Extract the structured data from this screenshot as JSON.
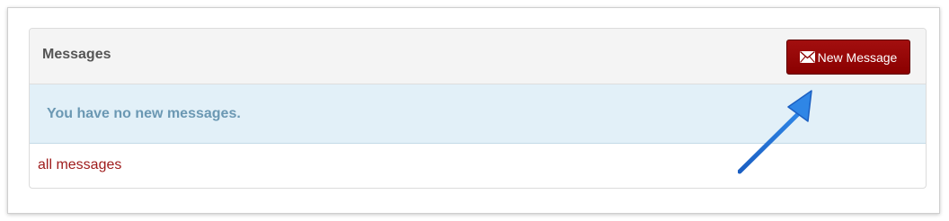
{
  "panel": {
    "title": "Messages",
    "new_message_label": "New Message",
    "new_message_icon": "envelope-icon",
    "empty_notice": "You have no new messages.",
    "all_messages_link": "all messages"
  },
  "annotation": {
    "arrow_icon": "pointer-arrow-icon",
    "arrow_color": "#1f6ed1"
  },
  "colors": {
    "button_bg": "#9a0606",
    "alert_bg": "#e2f0f8",
    "alert_text": "#6b98b3",
    "link": "#9e1a1a"
  }
}
